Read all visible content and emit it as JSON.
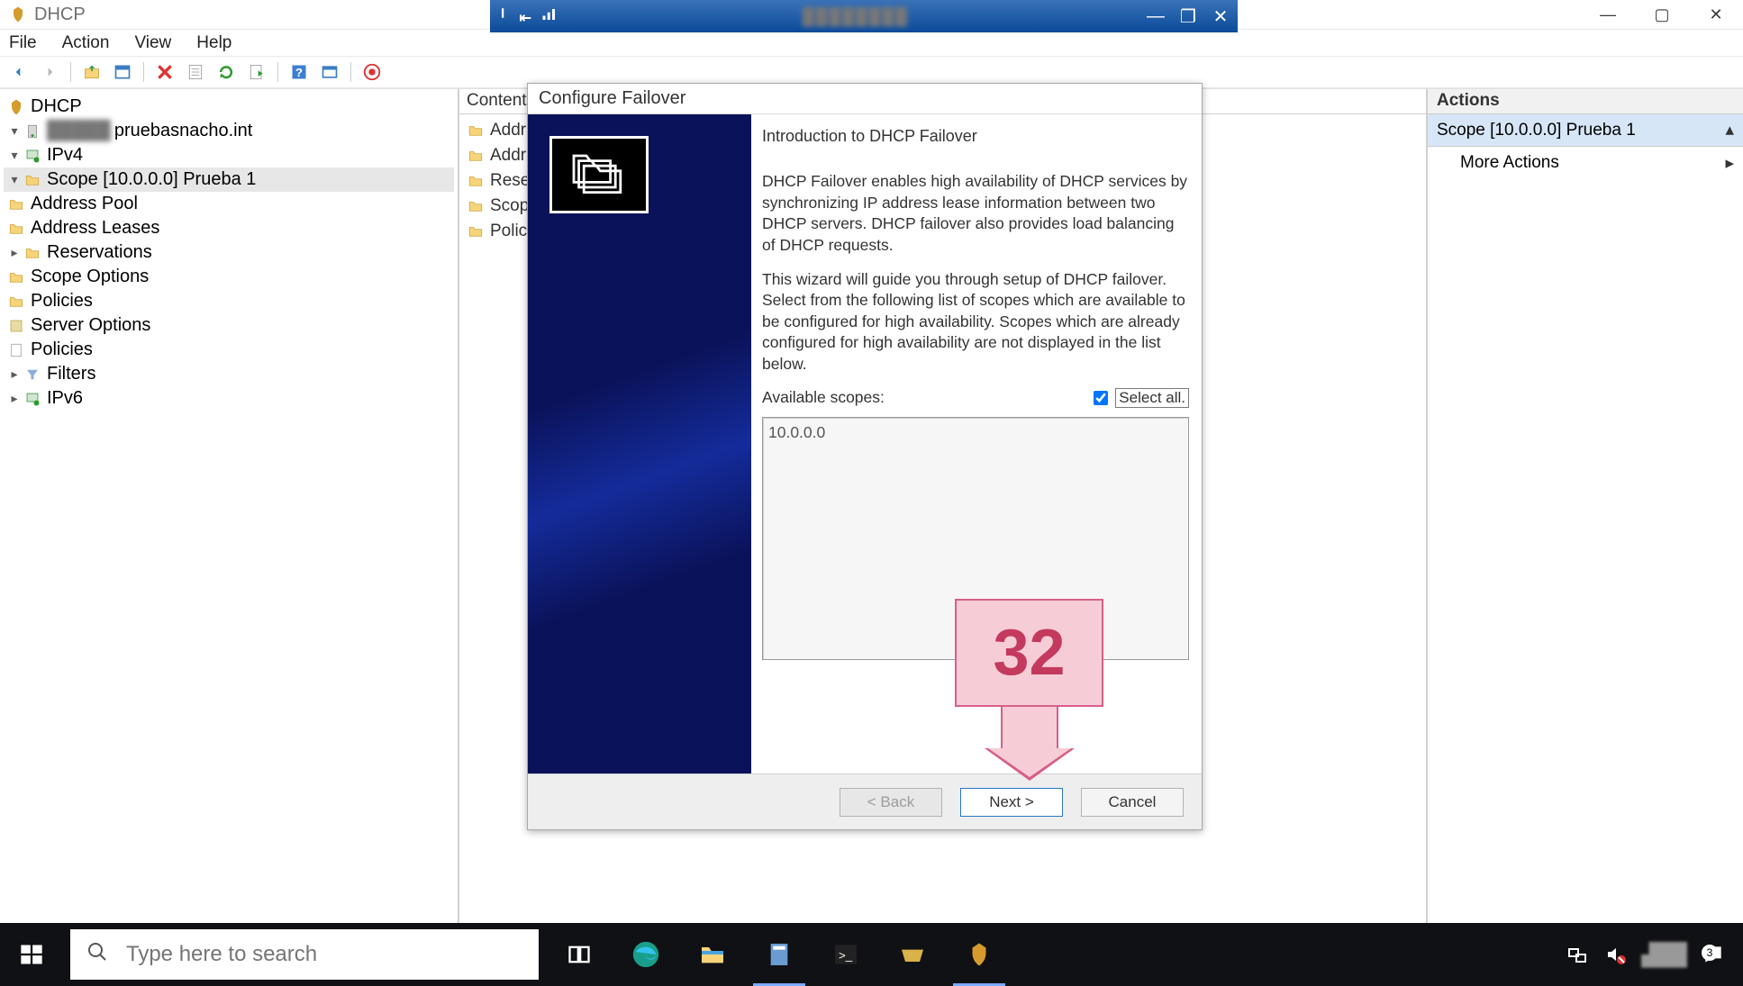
{
  "outer_window": {
    "title": "DHCP"
  },
  "menu": {
    "file": "File",
    "action": "Action",
    "view": "View",
    "help": "Help"
  },
  "blue_titlebar": {
    "signal_icon": "signal-icon"
  },
  "tree": {
    "root": "DHCP",
    "server": "pruebasnacho.int",
    "ipv4": "IPv4",
    "scope": "Scope [10.0.0.0] Prueba 1",
    "address_pool": "Address Pool",
    "address_leases": "Address Leases",
    "reservations": "Reservations",
    "scope_options": "Scope Options",
    "scope_policies": "Policies",
    "server_options": "Server Options",
    "server_policies": "Policies",
    "filters": "Filters",
    "ipv6": "IPv6"
  },
  "content": {
    "header": "Content",
    "items": [
      "Addr",
      "Addr",
      "Rese",
      "Scop",
      "Polici"
    ]
  },
  "actions": {
    "header": "Actions",
    "scope": "Scope [10.0.0.0] Prueba 1",
    "more": "More Actions"
  },
  "dialog": {
    "title": "Configure Failover",
    "heading": "Introduction to DHCP Failover",
    "para1": "DHCP Failover enables high availability of DHCP services by synchronizing IP address lease information between two DHCP servers. DHCP failover also provides load balancing of DHCP requests.",
    "para2": "This wizard will guide you through setup of DHCP failover. Select from the following list of scopes which are available to be configured for high availability. Scopes which are already configured for high availability are not displayed in the list below.",
    "available_label": "Available scopes:",
    "select_all_label": "Select all.",
    "scope_entry": "10.0.0.0",
    "back": "< Back",
    "next": "Next >",
    "cancel": "Cancel"
  },
  "callout": {
    "number": "32"
  },
  "taskbar": {
    "search_placeholder": "Type here to search",
    "notification_count": "3"
  }
}
